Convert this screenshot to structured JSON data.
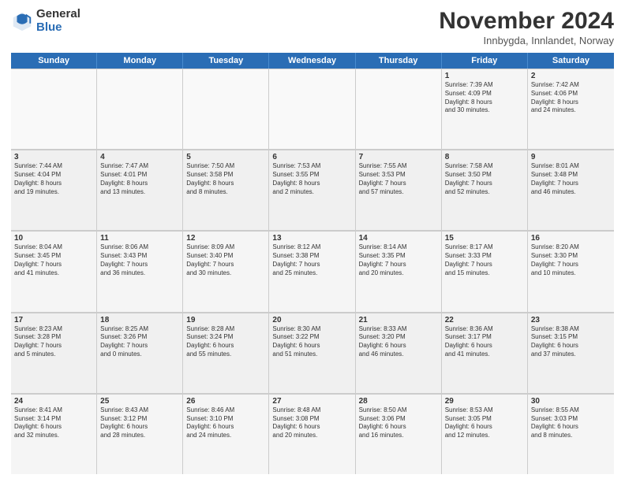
{
  "logo": {
    "general": "General",
    "blue": "Blue"
  },
  "title": "November 2024",
  "location": "Innbygda, Innlandet, Norway",
  "days": [
    "Sunday",
    "Monday",
    "Tuesday",
    "Wednesday",
    "Thursday",
    "Friday",
    "Saturday"
  ],
  "weeks": [
    [
      {
        "day": "",
        "info": ""
      },
      {
        "day": "",
        "info": ""
      },
      {
        "day": "",
        "info": ""
      },
      {
        "day": "",
        "info": ""
      },
      {
        "day": "",
        "info": ""
      },
      {
        "day": "1",
        "info": "Sunrise: 7:39 AM\nSunset: 4:09 PM\nDaylight: 8 hours\nand 30 minutes."
      },
      {
        "day": "2",
        "info": "Sunrise: 7:42 AM\nSunset: 4:06 PM\nDaylight: 8 hours\nand 24 minutes."
      }
    ],
    [
      {
        "day": "3",
        "info": "Sunrise: 7:44 AM\nSunset: 4:04 PM\nDaylight: 8 hours\nand 19 minutes."
      },
      {
        "day": "4",
        "info": "Sunrise: 7:47 AM\nSunset: 4:01 PM\nDaylight: 8 hours\nand 13 minutes."
      },
      {
        "day": "5",
        "info": "Sunrise: 7:50 AM\nSunset: 3:58 PM\nDaylight: 8 hours\nand 8 minutes."
      },
      {
        "day": "6",
        "info": "Sunrise: 7:53 AM\nSunset: 3:55 PM\nDaylight: 8 hours\nand 2 minutes."
      },
      {
        "day": "7",
        "info": "Sunrise: 7:55 AM\nSunset: 3:53 PM\nDaylight: 7 hours\nand 57 minutes."
      },
      {
        "day": "8",
        "info": "Sunrise: 7:58 AM\nSunset: 3:50 PM\nDaylight: 7 hours\nand 52 minutes."
      },
      {
        "day": "9",
        "info": "Sunrise: 8:01 AM\nSunset: 3:48 PM\nDaylight: 7 hours\nand 46 minutes."
      }
    ],
    [
      {
        "day": "10",
        "info": "Sunrise: 8:04 AM\nSunset: 3:45 PM\nDaylight: 7 hours\nand 41 minutes."
      },
      {
        "day": "11",
        "info": "Sunrise: 8:06 AM\nSunset: 3:43 PM\nDaylight: 7 hours\nand 36 minutes."
      },
      {
        "day": "12",
        "info": "Sunrise: 8:09 AM\nSunset: 3:40 PM\nDaylight: 7 hours\nand 30 minutes."
      },
      {
        "day": "13",
        "info": "Sunrise: 8:12 AM\nSunset: 3:38 PM\nDaylight: 7 hours\nand 25 minutes."
      },
      {
        "day": "14",
        "info": "Sunrise: 8:14 AM\nSunset: 3:35 PM\nDaylight: 7 hours\nand 20 minutes."
      },
      {
        "day": "15",
        "info": "Sunrise: 8:17 AM\nSunset: 3:33 PM\nDaylight: 7 hours\nand 15 minutes."
      },
      {
        "day": "16",
        "info": "Sunrise: 8:20 AM\nSunset: 3:30 PM\nDaylight: 7 hours\nand 10 minutes."
      }
    ],
    [
      {
        "day": "17",
        "info": "Sunrise: 8:23 AM\nSunset: 3:28 PM\nDaylight: 7 hours\nand 5 minutes."
      },
      {
        "day": "18",
        "info": "Sunrise: 8:25 AM\nSunset: 3:26 PM\nDaylight: 7 hours\nand 0 minutes."
      },
      {
        "day": "19",
        "info": "Sunrise: 8:28 AM\nSunset: 3:24 PM\nDaylight: 6 hours\nand 55 minutes."
      },
      {
        "day": "20",
        "info": "Sunrise: 8:30 AM\nSunset: 3:22 PM\nDaylight: 6 hours\nand 51 minutes."
      },
      {
        "day": "21",
        "info": "Sunrise: 8:33 AM\nSunset: 3:20 PM\nDaylight: 6 hours\nand 46 minutes."
      },
      {
        "day": "22",
        "info": "Sunrise: 8:36 AM\nSunset: 3:17 PM\nDaylight: 6 hours\nand 41 minutes."
      },
      {
        "day": "23",
        "info": "Sunrise: 8:38 AM\nSunset: 3:15 PM\nDaylight: 6 hours\nand 37 minutes."
      }
    ],
    [
      {
        "day": "24",
        "info": "Sunrise: 8:41 AM\nSunset: 3:14 PM\nDaylight: 6 hours\nand 32 minutes."
      },
      {
        "day": "25",
        "info": "Sunrise: 8:43 AM\nSunset: 3:12 PM\nDaylight: 6 hours\nand 28 minutes."
      },
      {
        "day": "26",
        "info": "Sunrise: 8:46 AM\nSunset: 3:10 PM\nDaylight: 6 hours\nand 24 minutes."
      },
      {
        "day": "27",
        "info": "Sunrise: 8:48 AM\nSunset: 3:08 PM\nDaylight: 6 hours\nand 20 minutes."
      },
      {
        "day": "28",
        "info": "Sunrise: 8:50 AM\nSunset: 3:06 PM\nDaylight: 6 hours\nand 16 minutes."
      },
      {
        "day": "29",
        "info": "Sunrise: 8:53 AM\nSunset: 3:05 PM\nDaylight: 6 hours\nand 12 minutes."
      },
      {
        "day": "30",
        "info": "Sunrise: 8:55 AM\nSunset: 3:03 PM\nDaylight: 6 hours\nand 8 minutes."
      }
    ]
  ]
}
